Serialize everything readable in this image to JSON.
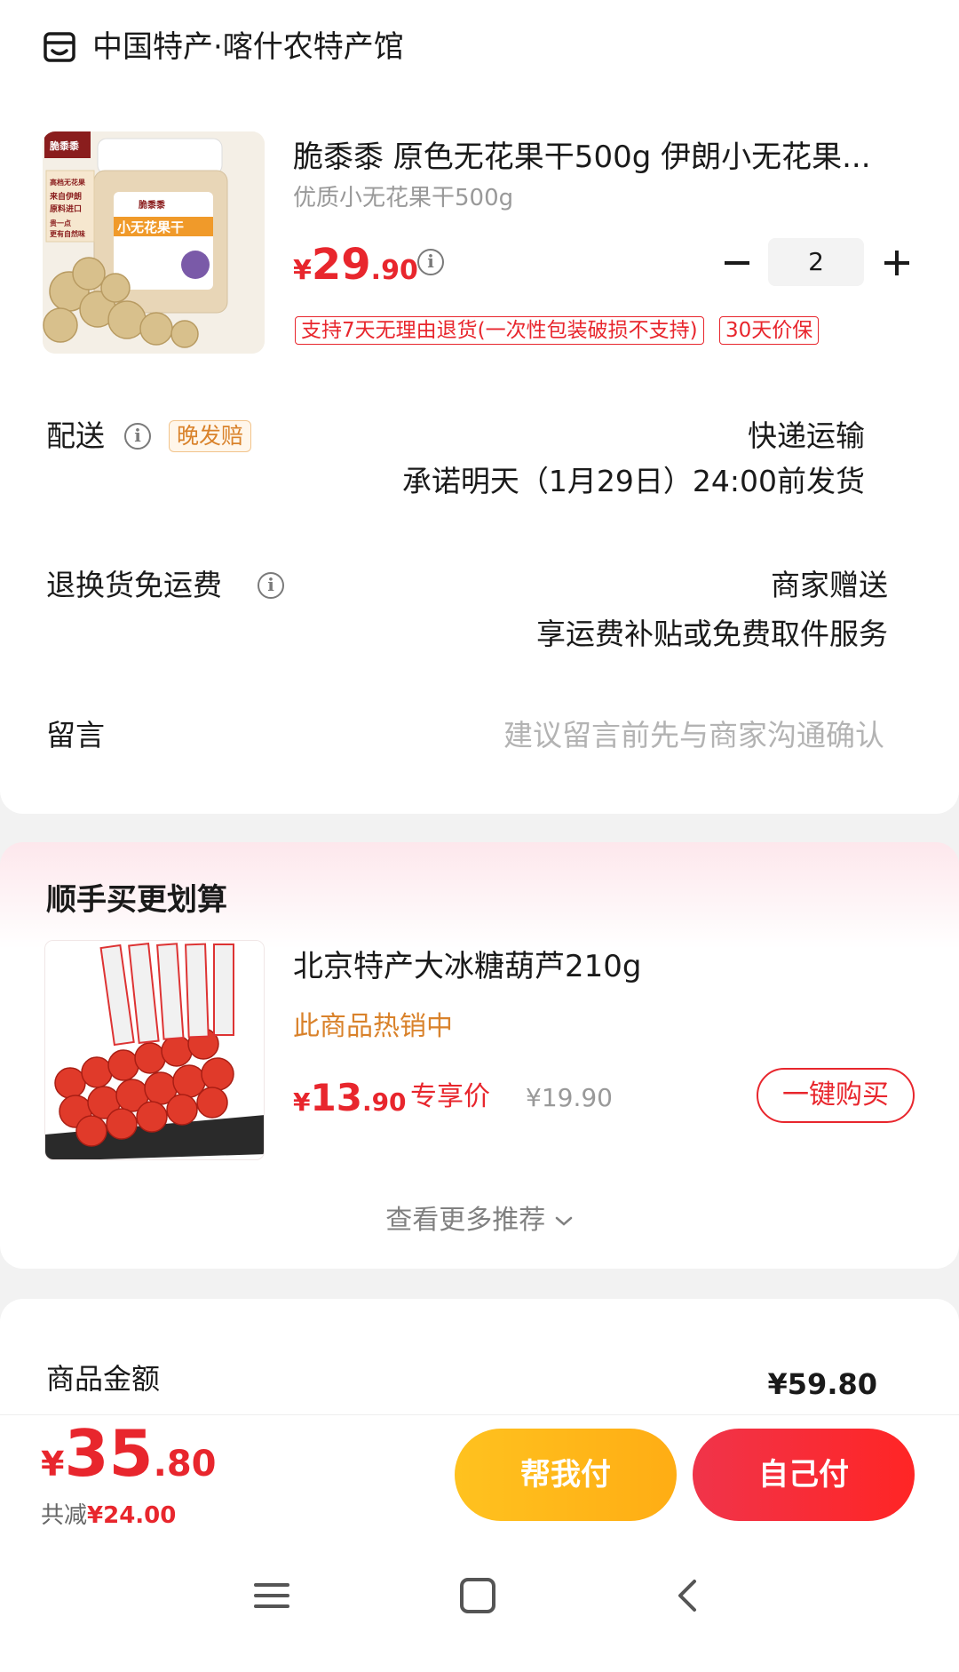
{
  "shop": {
    "name": "中国特产·喀什农特产馆",
    "icon": "shop-icon"
  },
  "product": {
    "title": "脆黍黍 原色无花果干500g 伊朗小无花果...",
    "spec": "优质小无花果干500g",
    "price_symbol": "¥",
    "price_int": "29",
    "price_dec": ".90",
    "quantity": "2",
    "tags": [
      "支持7天无理由退货(一次性包装破损不支持)",
      "30天价保"
    ],
    "image": {
      "brand": "脆黍黍",
      "label": "小无花果干",
      "side_texts": [
        "高档无花果",
        "来自伊朗",
        "原料进口",
        "贵一点",
        "更有自然味"
      ]
    }
  },
  "delivery": {
    "label": "配送",
    "badge": "晚发赔",
    "method": "快递运输",
    "promise": "承诺明天（1月29日）24:00前发货"
  },
  "return_shipping": {
    "label": "退换货免运费",
    "value": "商家赠送",
    "desc": "享运费补贴或免费取件服务"
  },
  "message": {
    "label": "留言",
    "placeholder": "建议留言前先与商家沟通确认"
  },
  "recommend": {
    "title": "顺手买更划算",
    "item": {
      "name": "北京特产大冰糖葫芦210g",
      "hot": "此商品热销中",
      "price_symbol": "¥",
      "price_int": "13",
      "price_dec": ".90",
      "exclusive": "专享价",
      "original": "¥19.90",
      "buy_label": "一键购买"
    },
    "more": "查看更多推荐"
  },
  "amount": {
    "label": "商品金额",
    "value": "¥59.80"
  },
  "pay": {
    "total_symbol": "¥",
    "total_int": "35",
    "total_dec": ".80",
    "discount_prefix": "共减",
    "discount_value": "¥24.00",
    "help_label": "帮我付",
    "self_label": "自己付"
  },
  "colors": {
    "accent": "#e8262d",
    "help": "#ffb81c",
    "hot": "#d9822b"
  }
}
